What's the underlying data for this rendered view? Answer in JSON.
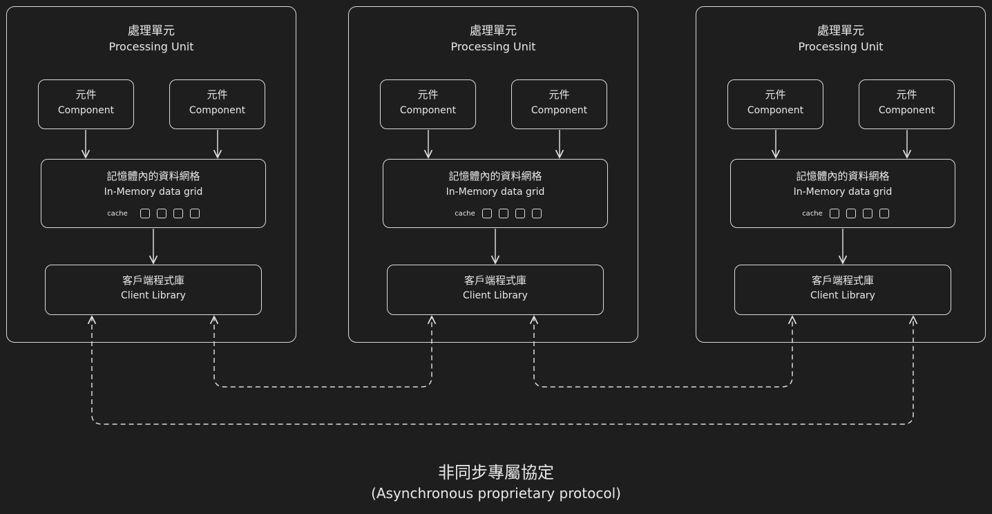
{
  "units": [
    {
      "title_zh": "處理單元",
      "title_en": "Processing Unit",
      "components": [
        {
          "zh": "元件",
          "en": "Component"
        },
        {
          "zh": "元件",
          "en": "Component"
        }
      ],
      "grid": {
        "zh": "記憶體內的資料網格",
        "en": "In-Memory data grid",
        "cache_label": "cache",
        "cache_slots": 4
      },
      "client": {
        "zh": "客戶端程式庫",
        "en": "Client Library"
      }
    },
    {
      "title_zh": "處理單元",
      "title_en": "Processing Unit",
      "components": [
        {
          "zh": "元件",
          "en": "Component"
        },
        {
          "zh": "元件",
          "en": "Component"
        }
      ],
      "grid": {
        "zh": "記憶體內的資料網格",
        "en": "In-Memory data grid",
        "cache_label": "cache",
        "cache_slots": 4
      },
      "client": {
        "zh": "客戶端程式庫",
        "en": "Client Library"
      }
    },
    {
      "title_zh": "處理單元",
      "title_en": "Processing Unit",
      "components": [
        {
          "zh": "元件",
          "en": "Component"
        },
        {
          "zh": "元件",
          "en": "Component"
        }
      ],
      "grid": {
        "zh": "記憶體內的資料網格",
        "en": "In-Memory data grid",
        "cache_label": "cache",
        "cache_slots": 4
      },
      "client": {
        "zh": "客戶端程式庫",
        "en": "Client Library"
      }
    }
  ],
  "protocol": {
    "zh": "非同步專屬協定",
    "en": "(Asynchronous proprietary protocol)"
  },
  "colors": {
    "background": "#1e1e1e",
    "stroke": "#dcdcdc",
    "text": "#e8e8e8"
  }
}
